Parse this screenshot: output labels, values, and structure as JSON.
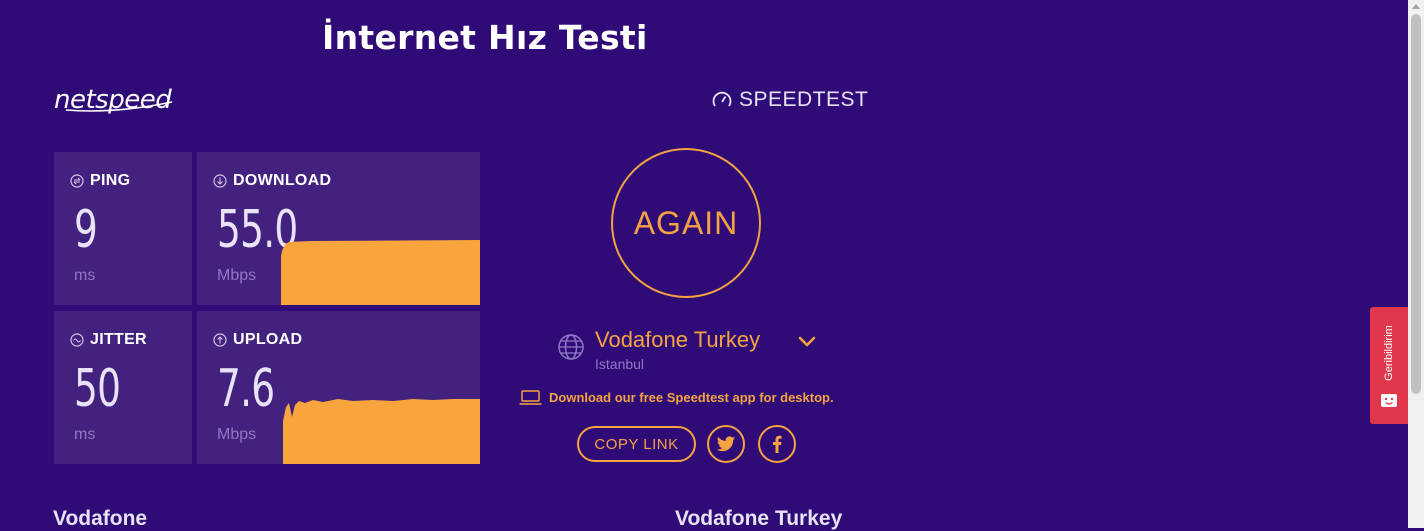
{
  "page": {
    "title": "İnternet Hız Testi"
  },
  "logo": {
    "text": "netspeed"
  },
  "metrics": {
    "ping": {
      "label": "PING",
      "value": "9",
      "unit": "ms"
    },
    "jitter": {
      "label": "JITTER",
      "value": "50",
      "unit": "ms"
    },
    "download": {
      "label": "DOWNLOAD",
      "value": "55.0",
      "unit": "Mbps"
    },
    "upload": {
      "label": "UPLOAD",
      "value": "7.6",
      "unit": "Mbps"
    }
  },
  "speedtest": {
    "brand": "SPEEDTEST",
    "again_label": "AGAIN",
    "provider": {
      "name": "Vodafone Turkey",
      "city": "Istanbul"
    },
    "desktop_promo": "Download our free Speedtest app for desktop.",
    "copy_link_label": "COPY LINK",
    "share_icons": [
      "twitter-icon",
      "facebook-icon"
    ]
  },
  "bottom": {
    "left_text": "Vodafone",
    "right_text": "Vodafone Turkey"
  },
  "feedback": {
    "label": "Geribildirim"
  },
  "colors": {
    "background": "#2f0b78",
    "tile": "#43227f",
    "accent": "#f5a241",
    "feedback": "#e1374c"
  }
}
